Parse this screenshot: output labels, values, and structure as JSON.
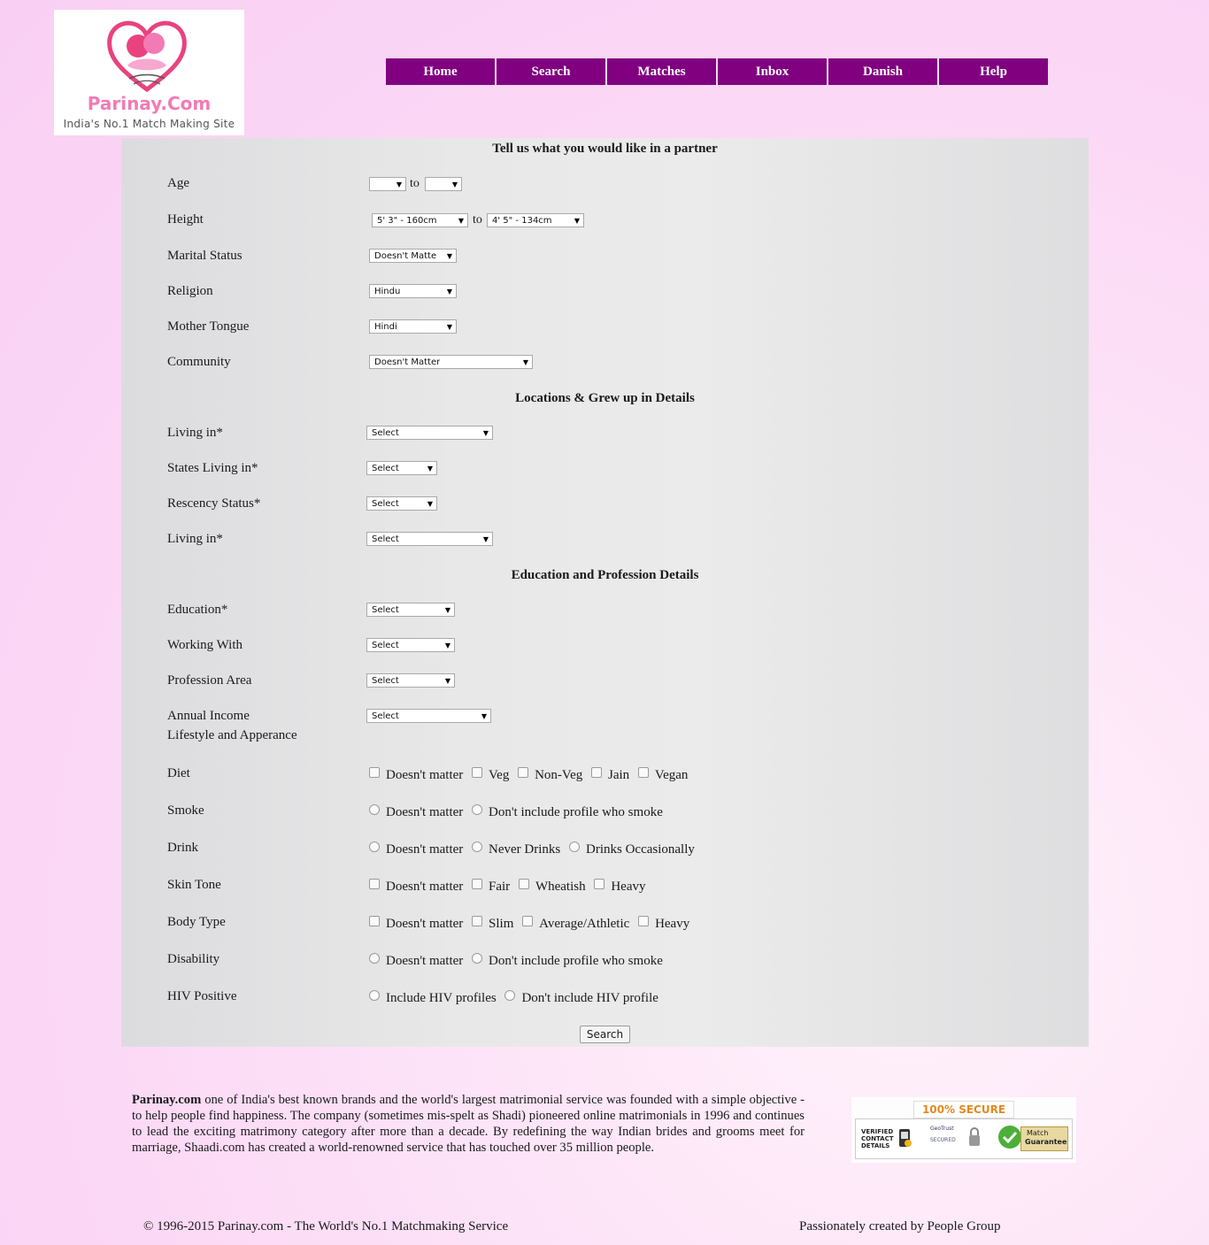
{
  "logo": {
    "brand": "Parinay.Com",
    "tagline": "India's No.1 Match Making Site"
  },
  "nav": [
    "Home",
    "Search",
    "Matches",
    "Inbox",
    "Danish",
    "Help"
  ],
  "colors": {
    "nav_bg": "#800080",
    "brand_pink": "#f27bb5",
    "badge_orange": "#e08a1e"
  },
  "form": {
    "title": "Tell us what you would like in a partner",
    "to_label": "to",
    "partner": {
      "age": {
        "label": "Age",
        "from": "",
        "to": ""
      },
      "height": {
        "label": "Height",
        "from": "5' 3\" - 160cm",
        "to": "4' 5\" - 134cm"
      },
      "marital_status": {
        "label": "Marital Status",
        "value": "Doesn't Matte"
      },
      "religion": {
        "label": "Religion",
        "value": "Hindu"
      },
      "mother_tongue": {
        "label": "Mother Tongue",
        "value": "Hindi"
      },
      "community": {
        "label": "Community",
        "value": "Doesn't Matter"
      }
    },
    "locations": {
      "title": "Locations & Grew up in Details",
      "living_in_1": {
        "label": "Living in*",
        "value": "Select"
      },
      "states_living_in": {
        "label": "States Living in*",
        "value": "Select"
      },
      "residency_status": {
        "label": "Rescency Status*",
        "value": "Select"
      },
      "living_in_2": {
        "label": "Living in*",
        "value": "Select"
      }
    },
    "education": {
      "title": "Education and Profession Details",
      "education": {
        "label": "Education*",
        "value": "Select"
      },
      "working_with": {
        "label": "Working With",
        "value": "Select"
      },
      "profession_area": {
        "label": "Profession Area",
        "value": "Select"
      },
      "annual_income": {
        "label": "Annual Income",
        "value": "Select"
      }
    },
    "lifestyle": {
      "title": "Lifestyle and Apperance",
      "diet": {
        "label": "Diet",
        "options": [
          "Doesn't matter",
          "Veg",
          "Non-Veg",
          "Jain",
          "Vegan"
        ]
      },
      "smoke": {
        "label": "Smoke",
        "options": [
          "Doesn't matter",
          "Don't include profile who smoke"
        ]
      },
      "drink": {
        "label": "Drink",
        "options": [
          "Doesn't matter",
          "Never Drinks",
          "Drinks Occasionally"
        ]
      },
      "skin_tone": {
        "label": "Skin Tone",
        "options": [
          "Doesn't matter",
          "Fair",
          "Wheatish",
          "Heavy"
        ]
      },
      "body_type": {
        "label": "Body Type",
        "options": [
          "Doesn't matter",
          "Slim",
          "Average/Athletic",
          "Heavy"
        ]
      },
      "disability": {
        "label": "Disability",
        "options": [
          "Doesn't matter",
          "Don't include profile who smoke"
        ]
      },
      "hiv": {
        "label": "HIV Positive",
        "options": [
          "Include HIV profiles",
          "Don't include HIV profile"
        ]
      }
    },
    "search_button": "Search"
  },
  "about": {
    "brand": "Parinay.com",
    "text": " one of India's best known brands and the world's largest matrimonial service was founded with a simple objective - to help people find happiness. The company (sometimes mis-spelt as Shadi) pioneered online matrimonials in 1996 and continues to lead the exciting matrimony category after more than a decade. By redefining the way Indian brides and grooms meet for marriage, Shaadi.com has created a world-renowned service that has touched over 35 million people."
  },
  "badge": {
    "title": "100% SECURE",
    "verified": "VERIFIED CONTACT DETAILS",
    "geotrust": "GeoTrust",
    "secured": "SECURED",
    "match": "Match",
    "guarantee": "Guarantee"
  },
  "footer": {
    "copyright": "© 1996-2015 Parinay.com - The World's No.1 Matchmaking Service",
    "credit": "Passionately created by People Group"
  }
}
